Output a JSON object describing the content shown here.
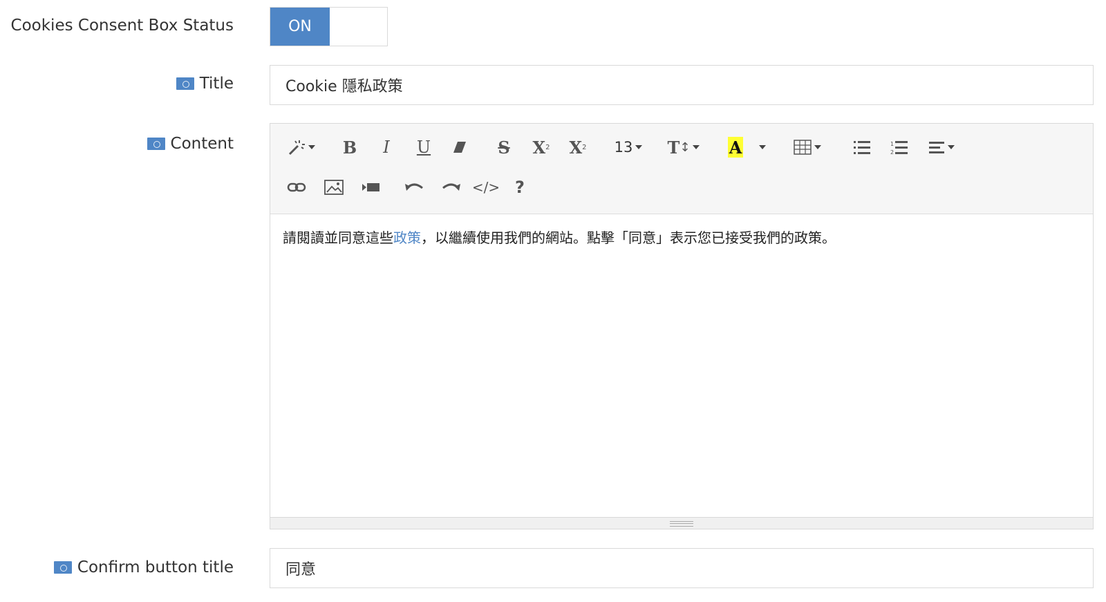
{
  "status": {
    "label": "Cookies Consent Box Status",
    "toggle_on_label": "ON"
  },
  "title_field": {
    "label": "Title",
    "value": "Cookie 隱私政策"
  },
  "content_field": {
    "label": "Content",
    "toolbar": {
      "font_size": "13",
      "bold": "B",
      "italic": "I",
      "underline": "U",
      "strike": "S",
      "superscript": "X",
      "subscript": "X",
      "text_color": "A",
      "help": "?",
      "code": "</>",
      "line_height": "T"
    },
    "text_before_link": "請閱讀並同意這些",
    "link_text": "政策",
    "text_after_link": "，以繼續使用我們的網站。點擊「同意」表示您已接受我們的政策。"
  },
  "confirm_field": {
    "label": "Confirm button title",
    "value": "同意"
  },
  "colors": {
    "accent": "#4f86c6",
    "highlight": "#ffff33"
  }
}
